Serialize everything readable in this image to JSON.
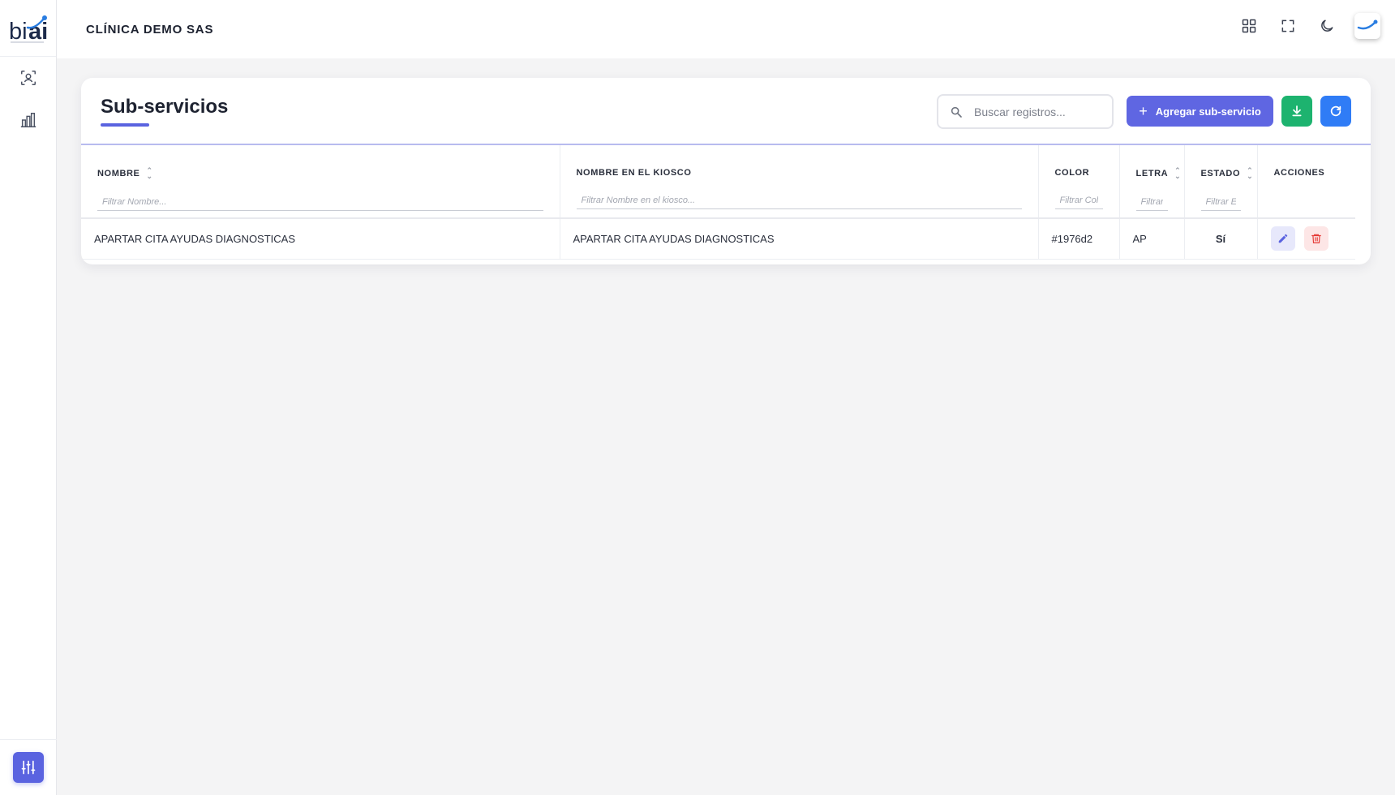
{
  "brand": {
    "logo_text": "biai",
    "accent": "#5a63e0"
  },
  "header": {
    "org_name": "CLÍNICA DEMO SAS",
    "icons": [
      "grid-icon",
      "fullscreen-icon",
      "moon-icon",
      "avatar"
    ]
  },
  "sidebar": {
    "items": [
      {
        "icon": "user-scan-icon"
      },
      {
        "icon": "bar-chart-icon"
      }
    ],
    "bottom_icon": "sliders-icon"
  },
  "page": {
    "title": "Sub-servicios",
    "search_placeholder": "Buscar registros...",
    "add_button_label": "Agregar sub-servicio",
    "download_icon": "download-icon",
    "refresh_icon": "refresh-icon"
  },
  "table": {
    "columns": [
      {
        "label": "NOMBRE",
        "filter_placeholder": "Filtrar Nombre...",
        "sortable": true
      },
      {
        "label": "NOMBRE EN EL KIOSCO",
        "filter_placeholder": "Filtrar Nombre en el kiosco...",
        "sortable": false
      },
      {
        "label": "COLOR",
        "filter_placeholder": "Filtrar Color...",
        "sortable": false
      },
      {
        "label": "LETRA",
        "filter_placeholder": "Filtrar Letra...",
        "sortable": true
      },
      {
        "label": "ESTADO",
        "filter_placeholder": "Filtrar Estado...",
        "sortable": true
      },
      {
        "label": "ACCIONES"
      }
    ],
    "rows": [
      {
        "nombre": "APARTAR CITA AYUDAS DIAGNOSTICAS",
        "nombre_kiosco": "APARTAR CITA AYUDAS DIAGNOSTICAS",
        "color": "#1976d2",
        "letra": "AP",
        "estado": "Sí"
      }
    ]
  },
  "colors": {
    "primary": "#5f66e2",
    "success": "#1db36f",
    "info": "#2f7cf6",
    "danger": "#e53935"
  }
}
